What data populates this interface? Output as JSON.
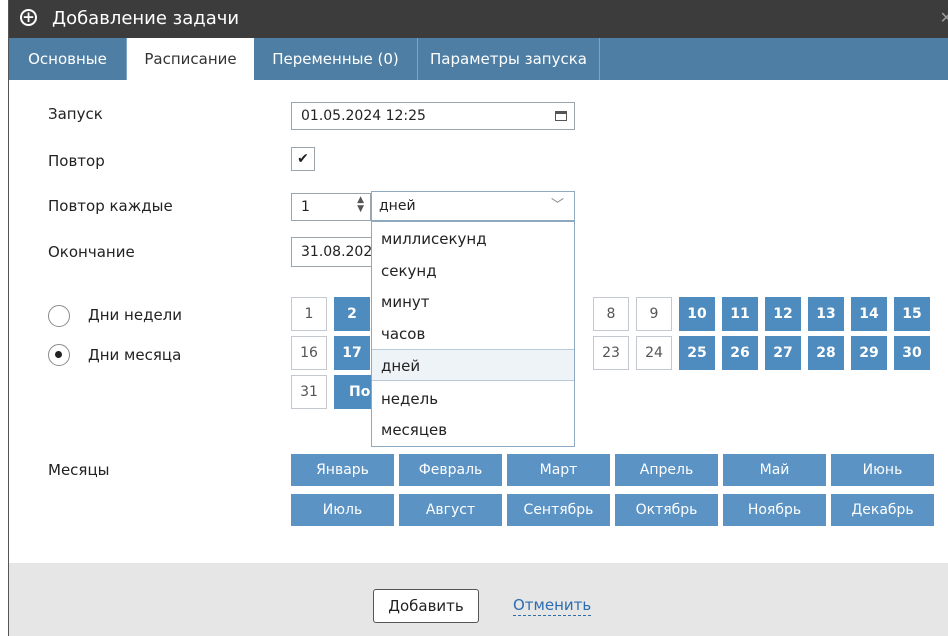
{
  "window": {
    "title": "Добавление задачи",
    "close_glyph": "✕"
  },
  "tabs": [
    {
      "label": "Основные"
    },
    {
      "label": "Расписание"
    },
    {
      "label": "Переменные (0)"
    },
    {
      "label": "Параметры запуска"
    }
  ],
  "active_tab": "Расписание",
  "form": {
    "start_label": "Запуск",
    "start_value": "01.05.2024 12:25",
    "repeat_label": "Повтор",
    "repeat_checked": true,
    "repeat_every_label": "Повтор каждые",
    "repeat_every_value": "1",
    "repeat_unit_value": "дней",
    "end_label": "Окончание",
    "end_value": "31.08.202"
  },
  "unit_options": [
    "миллисекунд",
    "секунд",
    "минут",
    "часов",
    "дней",
    "недель",
    "месяцев"
  ],
  "selected_unit": "дней",
  "mode": {
    "weekdays_label": "Дни недели",
    "monthdays_label": "Дни месяца",
    "selected": "monthdays"
  },
  "days": [
    {
      "n": "1",
      "on": false
    },
    {
      "n": "2",
      "on": true
    },
    {
      "n": "8",
      "on": false
    },
    {
      "n": "9",
      "on": false
    },
    {
      "n": "10",
      "on": true
    },
    {
      "n": "11",
      "on": true
    },
    {
      "n": "12",
      "on": true
    },
    {
      "n": "13",
      "on": true
    },
    {
      "n": "14",
      "on": true
    },
    {
      "n": "15",
      "on": true
    },
    {
      "n": "16",
      "on": false
    },
    {
      "n": "17",
      "on": true
    },
    {
      "n": "23",
      "on": false
    },
    {
      "n": "24",
      "on": false
    },
    {
      "n": "25",
      "on": true
    },
    {
      "n": "26",
      "on": true
    },
    {
      "n": "27",
      "on": true
    },
    {
      "n": "28",
      "on": true
    },
    {
      "n": "29",
      "on": true
    },
    {
      "n": "30",
      "on": true
    },
    {
      "n": "31",
      "on": false
    }
  ],
  "last_day_label": "По",
  "months_label": "Месяцы",
  "months": [
    "Январь",
    "Февраль",
    "Март",
    "Апрель",
    "Май",
    "Июнь",
    "Июль",
    "Август",
    "Сентябрь",
    "Октябрь",
    "Ноябрь",
    "Декабрь"
  ],
  "footer": {
    "add_label": "Добавить",
    "cancel_label": "Отменить"
  },
  "colors": {
    "titlebar": "#3c3c3c",
    "tabbar": "#4e7ea3",
    "day_on": "#4e8bbf",
    "month": "#5b93c4",
    "link": "#2c6db0"
  }
}
